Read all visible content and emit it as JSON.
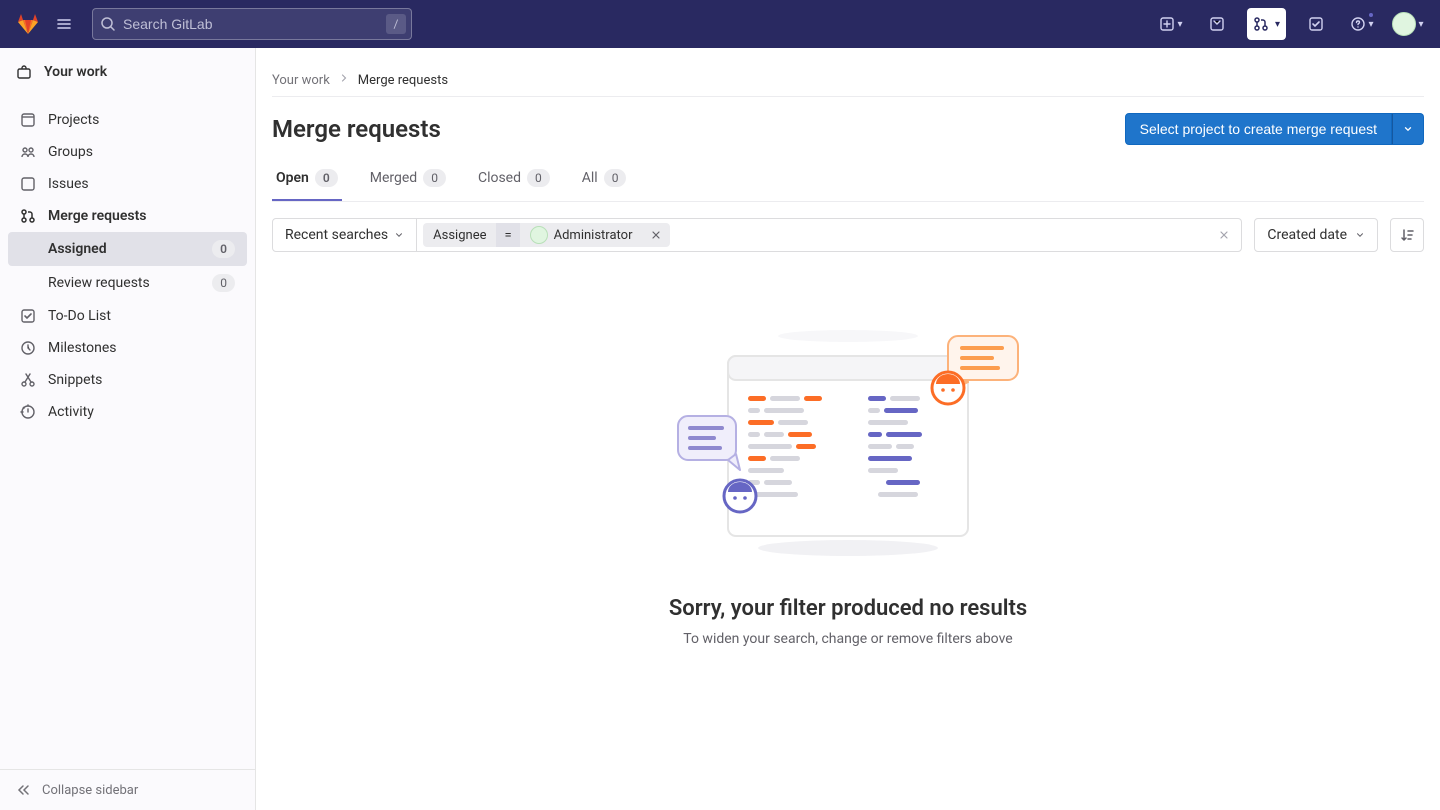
{
  "navbar": {
    "search_placeholder": "Search GitLab",
    "search_kbd": "/"
  },
  "sidebar": {
    "header": "Your work",
    "items": [
      {
        "label": "Projects"
      },
      {
        "label": "Groups"
      },
      {
        "label": "Issues"
      },
      {
        "label": "Merge requests"
      },
      {
        "label": "To-Do List"
      },
      {
        "label": "Milestones"
      },
      {
        "label": "Snippets"
      },
      {
        "label": "Activity"
      }
    ],
    "sub_items": [
      {
        "label": "Assigned",
        "count": "0",
        "active": true
      },
      {
        "label": "Review requests",
        "count": "0",
        "active": false
      }
    ],
    "collapse_label": "Collapse sidebar"
  },
  "breadcrumbs": {
    "parent": "Your work",
    "current": "Merge requests"
  },
  "page": {
    "title": "Merge requests",
    "primary_button": "Select project to create merge request"
  },
  "tabs": [
    {
      "label": "Open",
      "count": "0"
    },
    {
      "label": "Merged",
      "count": "0"
    },
    {
      "label": "Closed",
      "count": "0"
    },
    {
      "label": "All",
      "count": "0"
    }
  ],
  "filter": {
    "recent_label": "Recent searches",
    "chip_key": "Assignee",
    "chip_op": "=",
    "chip_value": "Administrator",
    "sort_label": "Created date"
  },
  "empty": {
    "title": "Sorry, your filter produced no results",
    "subtitle": "To widen your search, change or remove filters above"
  }
}
